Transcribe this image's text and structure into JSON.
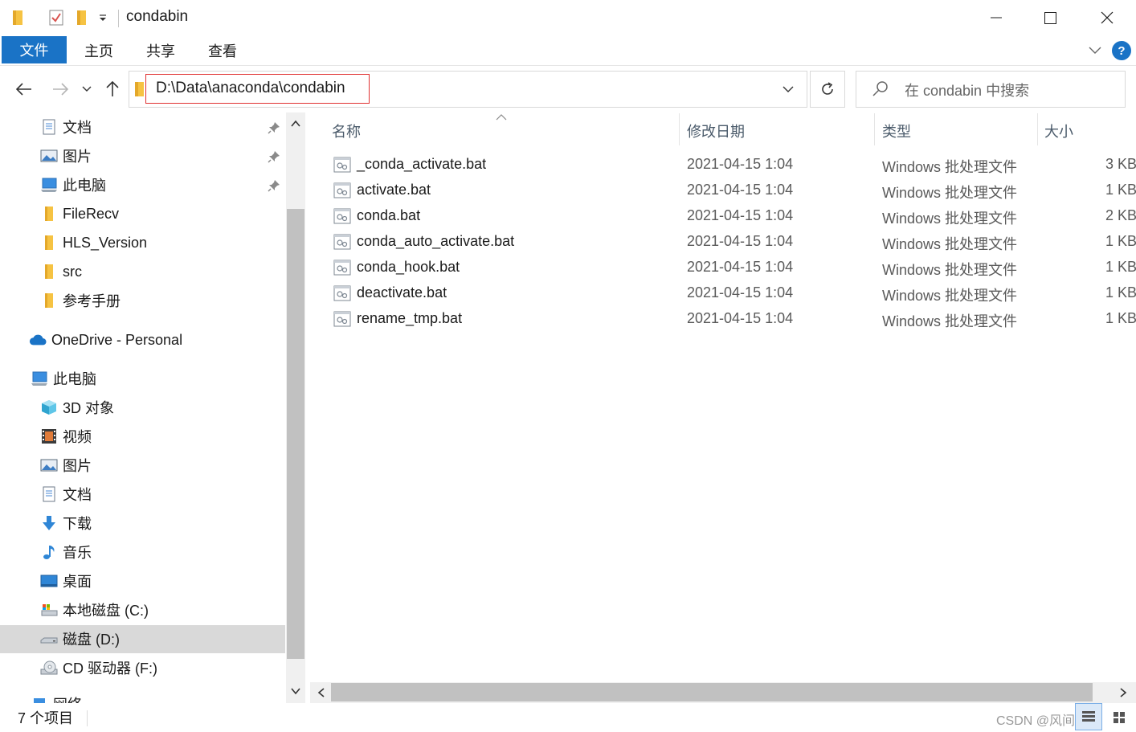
{
  "window": {
    "title": "condabin",
    "minimize_glyph": "—",
    "close_glyph": "✕"
  },
  "ribbon": {
    "tabs": [
      "文件",
      "主页",
      "共享",
      "查看"
    ],
    "help_label": "?"
  },
  "address": {
    "path": "D:\\Data\\anaconda\\condabin",
    "search_placeholder": "在 condabin 中搜索"
  },
  "nav": {
    "quick_access": [
      {
        "label": "文档",
        "icon": "document-icon",
        "pinned": true
      },
      {
        "label": "图片",
        "icon": "pictures-icon",
        "pinned": true
      },
      {
        "label": "此电脑",
        "icon": "computer-icon",
        "pinned": true
      },
      {
        "label": "FileRecv",
        "icon": "folder-icon",
        "pinned": false
      },
      {
        "label": "HLS_Version",
        "icon": "folder-icon",
        "pinned": false
      },
      {
        "label": "src",
        "icon": "folder-icon",
        "pinned": false
      },
      {
        "label": "参考手册",
        "icon": "folder-icon",
        "pinned": false
      }
    ],
    "onedrive": "OneDrive - Personal",
    "this_pc": "此电脑",
    "pc_items": [
      {
        "label": "3D 对象",
        "icon": "3d-objects-icon"
      },
      {
        "label": "视频",
        "icon": "videos-icon"
      },
      {
        "label": "图片",
        "icon": "pictures-icon"
      },
      {
        "label": "文档",
        "icon": "document-icon"
      },
      {
        "label": "下载",
        "icon": "download-icon"
      },
      {
        "label": "音乐",
        "icon": "music-icon"
      },
      {
        "label": "桌面",
        "icon": "desktop-icon"
      },
      {
        "label": "本地磁盘 (C:)",
        "icon": "drive-icon"
      },
      {
        "label": "磁盘 (D:)",
        "icon": "drive-icon"
      },
      {
        "label": "CD 驱动器 (F:)",
        "icon": "cd-drive-icon"
      }
    ],
    "network_partial": "网络",
    "selected": "磁盘 (D:)"
  },
  "columns": {
    "name": "名称",
    "date": "修改日期",
    "type": "类型",
    "size": "大小"
  },
  "files": [
    {
      "name": "_conda_activate.bat",
      "date": "2021-04-15 1:04",
      "type": "Windows 批处理文件",
      "size": "3 KB"
    },
    {
      "name": "activate.bat",
      "date": "2021-04-15 1:04",
      "type": "Windows 批处理文件",
      "size": "1 KB"
    },
    {
      "name": "conda.bat",
      "date": "2021-04-15 1:04",
      "type": "Windows 批处理文件",
      "size": "2 KB"
    },
    {
      "name": "conda_auto_activate.bat",
      "date": "2021-04-15 1:04",
      "type": "Windows 批处理文件",
      "size": "1 KB"
    },
    {
      "name": "conda_hook.bat",
      "date": "2021-04-15 1:04",
      "type": "Windows 批处理文件",
      "size": "1 KB"
    },
    {
      "name": "deactivate.bat",
      "date": "2021-04-15 1:04",
      "type": "Windows 批处理文件",
      "size": "1 KB"
    },
    {
      "name": "rename_tmp.bat",
      "date": "2021-04-15 1:04",
      "type": "Windows 批处理文件",
      "size": "1 KB"
    }
  ],
  "status": {
    "item_count": "7 个项目",
    "watermark": "CSDN @风间琉璃"
  },
  "colors": {
    "accent": "#1a73c6",
    "highlight_border": "#e03131",
    "selected_bg": "#d9d9d9"
  }
}
